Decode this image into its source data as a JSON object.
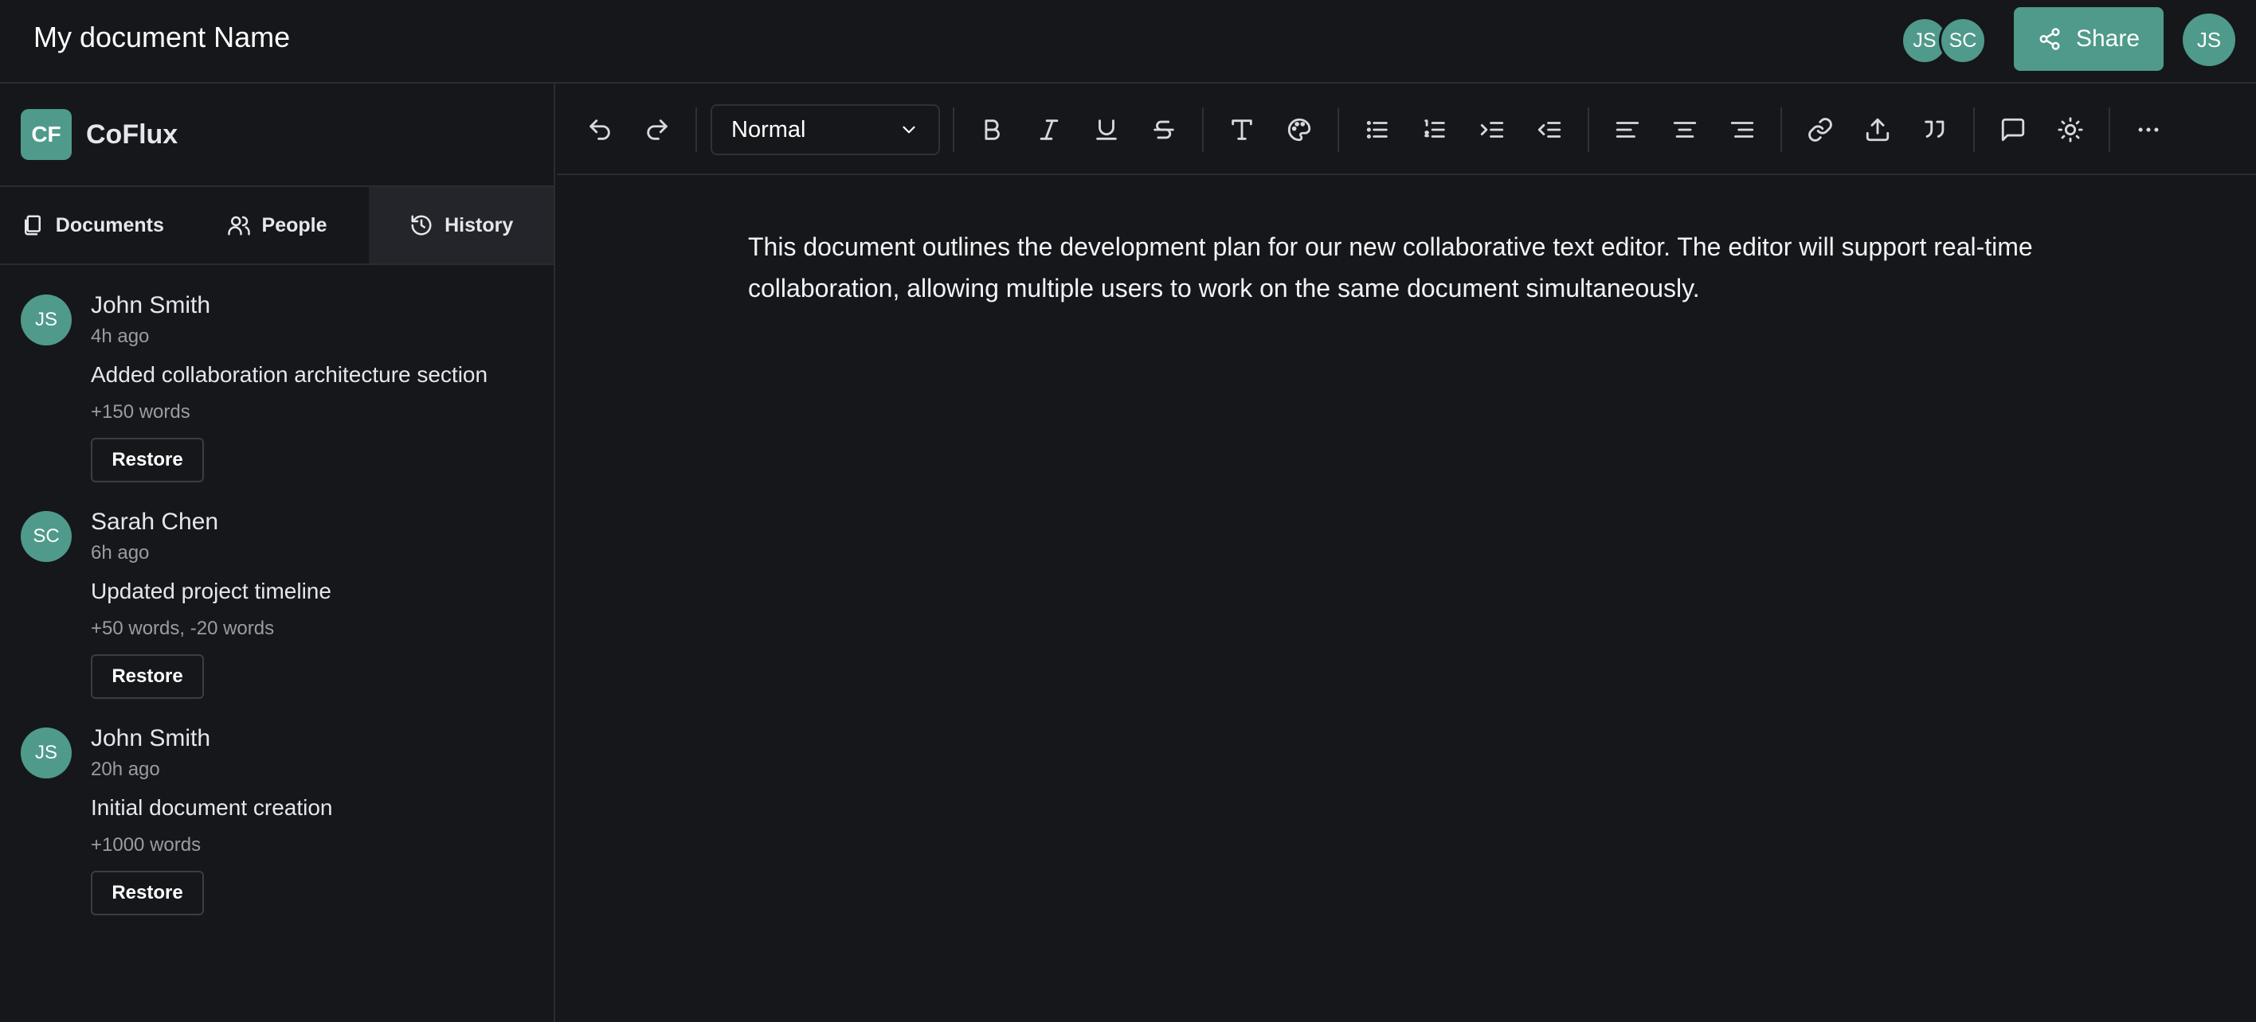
{
  "header": {
    "doc_title": "My document Name",
    "collaborators": [
      "JS",
      "SC"
    ],
    "share_label": "Share",
    "current_user": "JS"
  },
  "sidebar": {
    "brand_initials": "CF",
    "brand_name": "CoFlux",
    "tabs": [
      {
        "label": "Documents",
        "icon": "documents-icon"
      },
      {
        "label": "People",
        "icon": "people-icon"
      },
      {
        "label": "History",
        "icon": "history-icon",
        "active": true
      }
    ],
    "history": [
      {
        "initials": "JS",
        "name": "John Smith",
        "time": "4h ago",
        "message": "Added collaboration architecture section",
        "delta": "+150 words",
        "action": "Restore"
      },
      {
        "initials": "SC",
        "name": "Sarah Chen",
        "time": "6h ago",
        "message": "Updated project timeline",
        "delta": "+50 words, -20 words",
        "action": "Restore"
      },
      {
        "initials": "JS",
        "name": "John Smith",
        "time": "20h ago",
        "message": "Initial document creation",
        "delta": "+1000 words",
        "action": "Restore"
      }
    ]
  },
  "toolbar": {
    "style_value": "Normal",
    "icons": [
      "undo-icon",
      "redo-icon",
      "bold-icon",
      "italic-icon",
      "underline-icon",
      "strikethrough-icon",
      "text-icon",
      "palette-icon",
      "bullet-list-icon",
      "numbered-list-icon",
      "indent-icon",
      "outdent-icon",
      "align-left-icon",
      "align-center-icon",
      "align-right-icon",
      "link-icon",
      "upload-icon",
      "quote-icon",
      "comment-icon",
      "theme-icon",
      "more-icon"
    ]
  },
  "editor": {
    "content": "This document outlines the development plan for our new collaborative text editor. The editor will support real-time collaboration, allowing multiple users to work on the same document simultaneously."
  },
  "colors": {
    "accent": "#4f9a8b",
    "background": "#16171b",
    "active_tab": "#23252b"
  }
}
